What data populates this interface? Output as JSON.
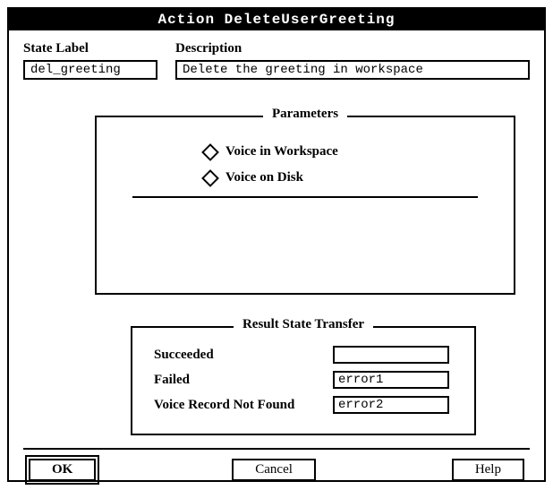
{
  "title": "Action DeleteUserGreeting",
  "state_label": {
    "label": "State Label",
    "value": "del_greeting"
  },
  "description": {
    "label": "Description",
    "value": "Delete the greeting in workspace"
  },
  "parameters": {
    "legend": "Parameters",
    "options": [
      {
        "label": "Voice in Workspace"
      },
      {
        "label": "Voice on Disk"
      }
    ]
  },
  "result_transfer": {
    "legend": "Result State Transfer",
    "rows": [
      {
        "label": "Succeeded",
        "value": ""
      },
      {
        "label": "Failed",
        "value": "error1"
      },
      {
        "label": "Voice Record Not Found",
        "value": "error2"
      }
    ]
  },
  "buttons": {
    "ok": "OK",
    "cancel": "Cancel",
    "help": "Help"
  }
}
